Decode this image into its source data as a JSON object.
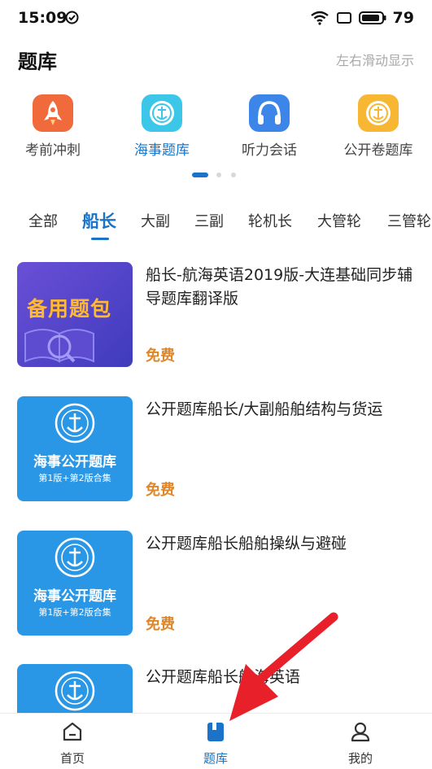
{
  "status_bar": {
    "time": "15:09",
    "battery": "79"
  },
  "header": {
    "title": "题库",
    "hint": "左右滑动显示"
  },
  "categories": [
    {
      "label": "考前冲刺",
      "icon": "rocket-icon",
      "color": "#f06a3c"
    },
    {
      "label": "海事题库",
      "icon": "msa-emblem-icon",
      "color": "#3cc7e8"
    },
    {
      "label": "听力会话",
      "icon": "headphones-icon",
      "color": "#3b86e8"
    },
    {
      "label": "公开卷题库",
      "icon": "msa-emblem-icon",
      "color": "#f7b733"
    }
  ],
  "tabs": [
    "全部",
    "船长",
    "大副",
    "三副",
    "轮机长",
    "大管轮",
    "三管轮"
  ],
  "active_tab": "船长",
  "items": [
    {
      "name": "船长-航海英语2019版-大连基础同步辅导题库翻译版",
      "price": "免费",
      "thumb_title": "备用题包"
    },
    {
      "name": "公开题库船长/大副船舶结构与货运",
      "price": "免费",
      "thumb_title": "海事公开题库",
      "thumb_sub": "第1版+第2版合集"
    },
    {
      "name": "公开题库船长船舶操纵与避碰",
      "price": "免费",
      "thumb_title": "海事公开题库",
      "thumb_sub": "第1版+第2版合集"
    },
    {
      "name": "公开题库船长航海英语",
      "thumb_title": "",
      "thumb_sub": ""
    }
  ],
  "bottom_nav": [
    {
      "label": "首页",
      "icon": "home-icon"
    },
    {
      "label": "题库",
      "icon": "bank-icon"
    },
    {
      "label": "我的",
      "icon": "profile-icon"
    }
  ],
  "colors": {
    "accent": "#1a73c8",
    "price": "#e0862a"
  }
}
